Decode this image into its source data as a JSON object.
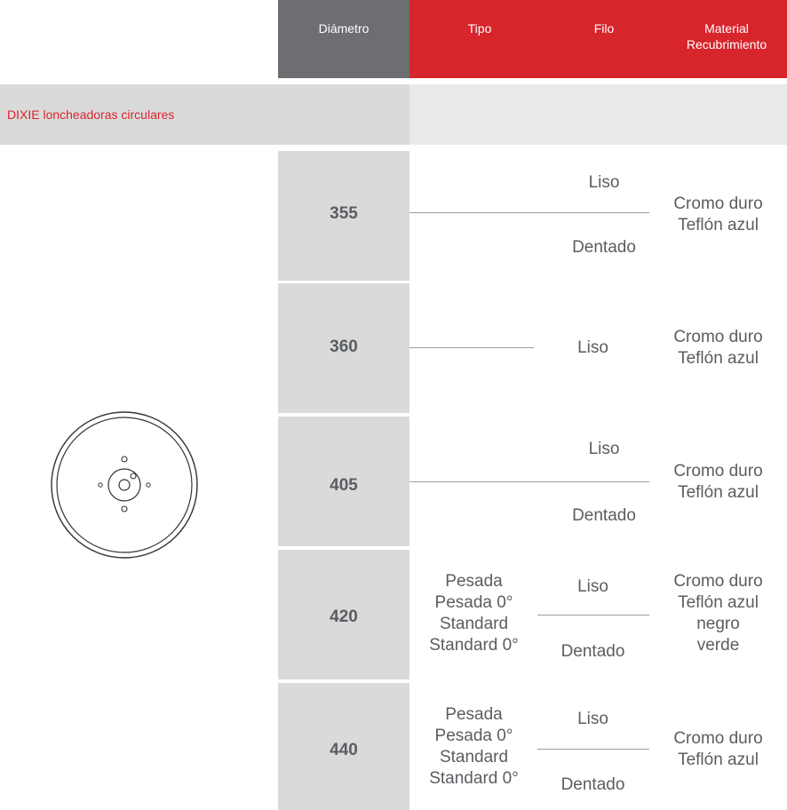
{
  "header": {
    "diametro": "Diámetro",
    "tipo": "Tipo",
    "filo": "Filo",
    "material_line1": "Material",
    "material_line2": "Recubrimiento"
  },
  "section": {
    "title": "DIXIE loncheadoras circulares"
  },
  "rows": [
    {
      "diametro": "355",
      "filo": [
        "Liso",
        "Dentado"
      ],
      "material": [
        "Cromo duro",
        "Teflón azul"
      ]
    },
    {
      "diametro": "360",
      "filo": [
        "Liso"
      ],
      "material": [
        "Cromo duro",
        "Teflón azul"
      ]
    },
    {
      "diametro": "405",
      "filo": [
        "Liso",
        "Dentado"
      ],
      "material": [
        "Cromo duro",
        "Teflón azul"
      ]
    },
    {
      "diametro": "420",
      "tipo": [
        "Pesada",
        "Pesada 0°",
        "Standard",
        "Standard 0°"
      ],
      "filo": [
        "Liso",
        "Dentado"
      ],
      "material": [
        "Cromo duro",
        "Teflón azul",
        "negro",
        "verde"
      ]
    },
    {
      "diametro": "440",
      "tipo": [
        "Pesada",
        "Pesada 0°",
        "Standard",
        "Standard 0°"
      ],
      "filo": [
        "Liso",
        "Dentado"
      ],
      "material": [
        "Cromo duro",
        "Teflón azul"
      ]
    }
  ],
  "colors": {
    "accent_red": "#d7252c",
    "header_gray": "#6c6e71",
    "cell_gray": "#dadadb"
  },
  "icons": {
    "product": "circular-blade-icon"
  }
}
